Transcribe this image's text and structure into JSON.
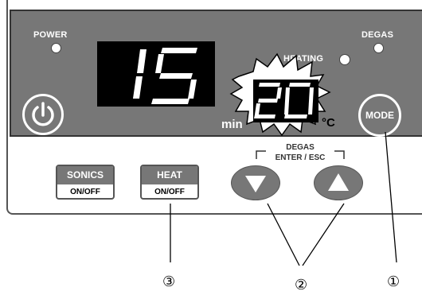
{
  "indicators": {
    "power_label": "POWER",
    "degas_label": "DEGAS",
    "heating_label": "HEATING"
  },
  "displays": {
    "time_value": "15",
    "time_unit": "min",
    "temp_value": "20",
    "temp_unit": "°C"
  },
  "buttons": {
    "mode_label": "MODE",
    "sonics": {
      "top": "SONICS",
      "bottom": "ON/OFF"
    },
    "heat": {
      "top": "HEAT",
      "bottom": "ON/OFF"
    },
    "arrow_group_label_1": "DEGAS",
    "arrow_group_label_2": "ENTER / ESC"
  },
  "callouts": {
    "c1": "①",
    "c2": "②",
    "c3": "③"
  },
  "colors": {
    "panel": "#777777",
    "display_bg": "#000000",
    "segment": "#ffffff"
  }
}
